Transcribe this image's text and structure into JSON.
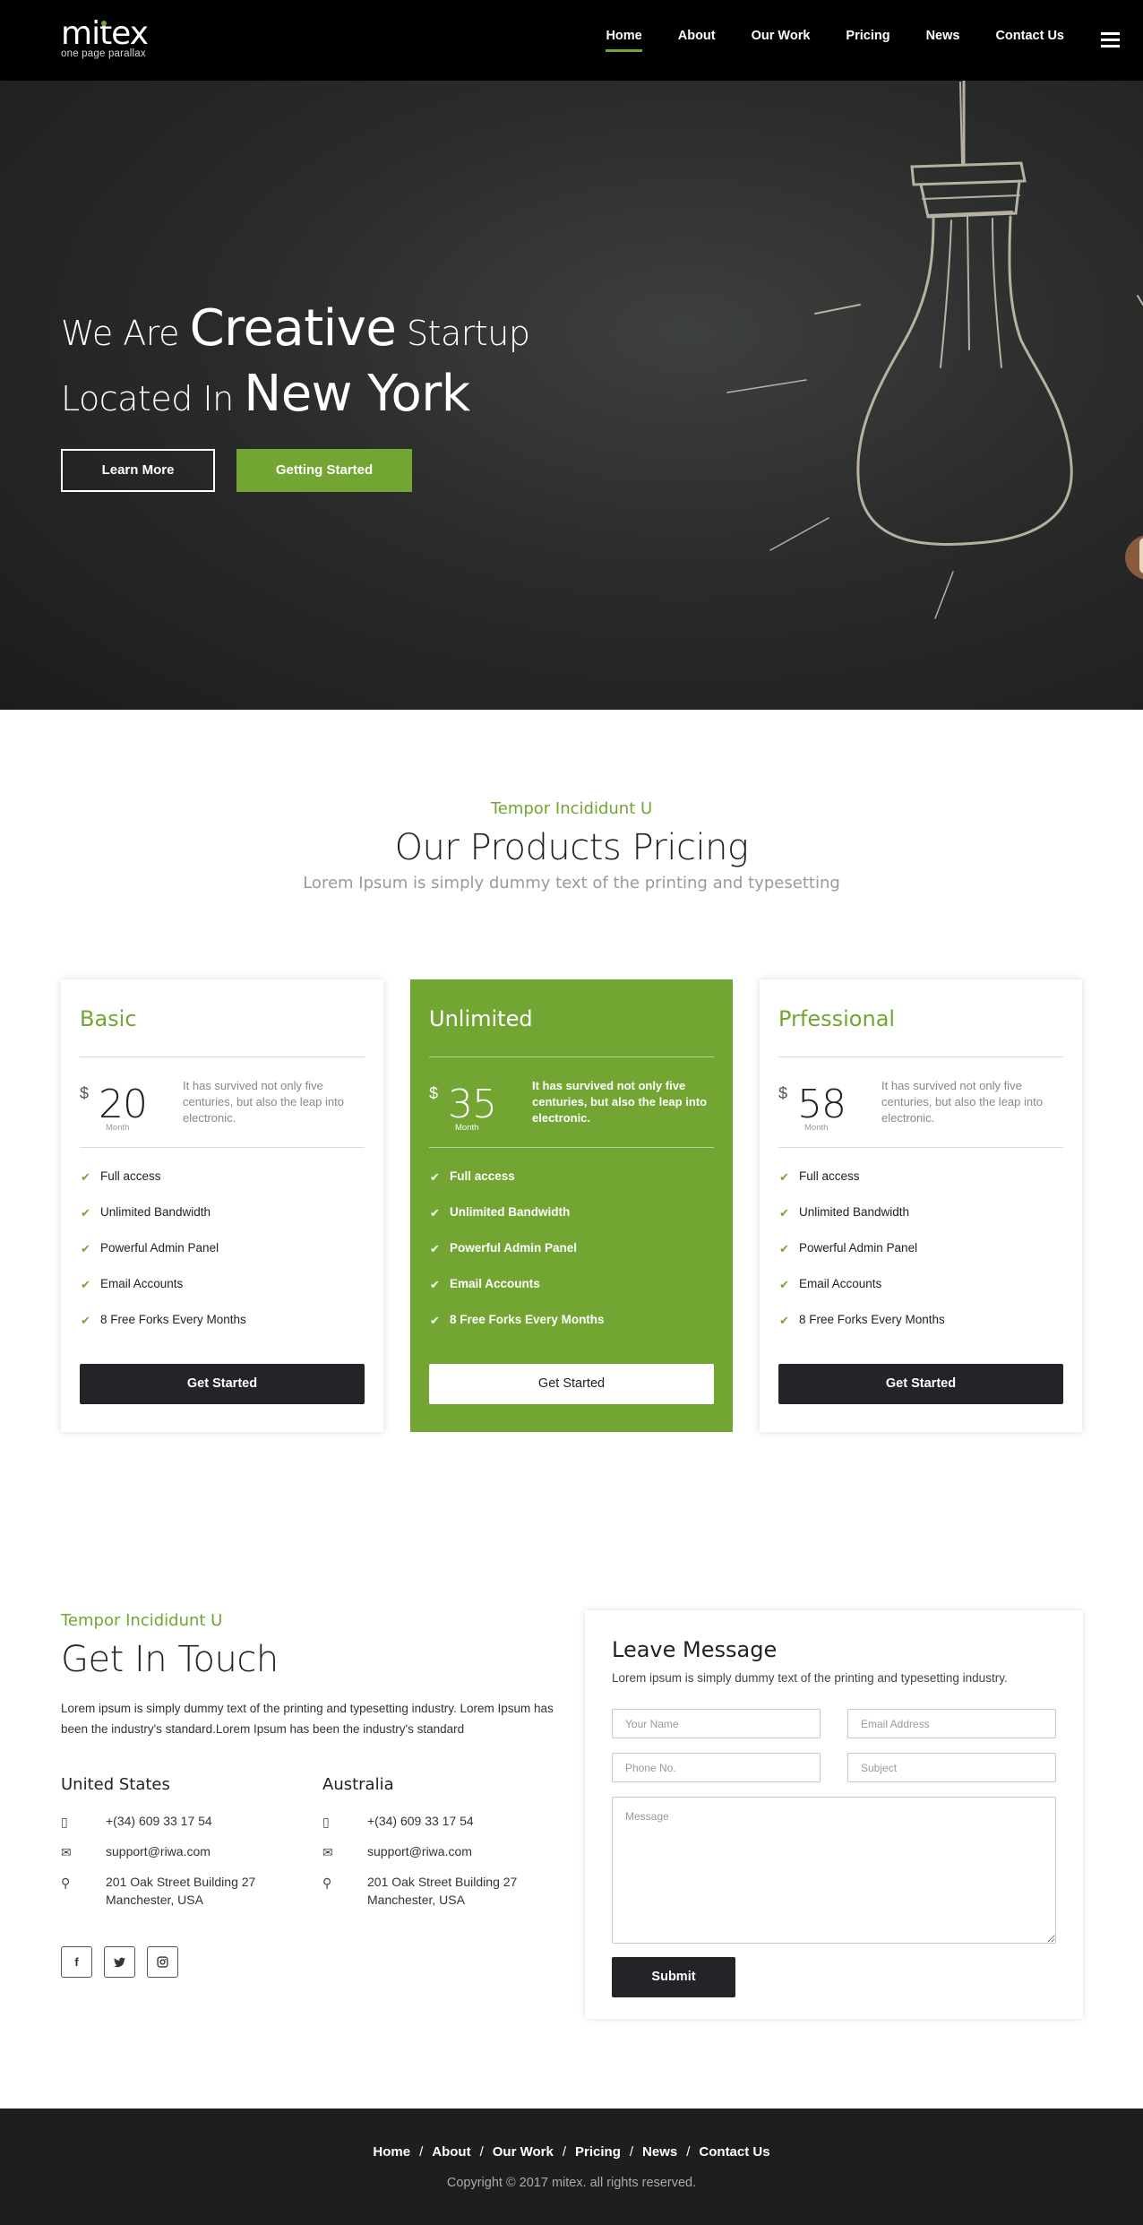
{
  "brand": {
    "name": "mitex",
    "tagline": "one page parallax",
    "accent": "#73a533",
    "dark": "#232428"
  },
  "nav": {
    "links": [
      "Home",
      "About",
      "Our Work",
      "Pricing",
      "News",
      "Contact Us"
    ],
    "active": "Home",
    "menu_icon": "hamburger-icon"
  },
  "hero": {
    "line1_pre": "We Are",
    "line1_big": "Creative",
    "line1_post": "Startup",
    "line2_pre": "Located In",
    "line2_big": "New York",
    "btn_learn": "Learn More",
    "btn_start": "Getting Started"
  },
  "pricing": {
    "eyebrow": "Tempor Incididunt U",
    "title": "Our Products Pricing",
    "subtitle": "Lorem Ipsum is simply dummy text of the printing and typesetting",
    "plans": [
      {
        "name": "Basic",
        "currency": "$",
        "price": "20",
        "period": "Month",
        "desc": "It has survived not only five centuries, but also the leap into electronic.",
        "features": [
          "Full access",
          "Unlimited Bandwidth",
          "Powerful Admin Panel",
          "Email Accounts",
          "8 Free Forks Every Months"
        ],
        "cta": "Get Started"
      },
      {
        "name": "Unlimited",
        "currency": "$",
        "price": "35",
        "period": "Month",
        "desc": "It has survived not only five centuries, but also the leap into electronic.",
        "features": [
          "Full access",
          "Unlimited Bandwidth",
          "Powerful Admin Panel",
          "Email Accounts",
          "8 Free Forks Every Months"
        ],
        "cta": "Get Started"
      },
      {
        "name": "Prfessional",
        "currency": "$",
        "price": "58",
        "period": "Month",
        "desc": "It has survived not only five centuries, but also the leap into electronic.",
        "features": [
          "Full access",
          "Unlimited Bandwidth",
          "Powerful Admin Panel",
          "Email Accounts",
          "8 Free Forks Every Months"
        ],
        "cta": "Get Started"
      }
    ]
  },
  "contact": {
    "eyebrow": "Tempor Incididunt U",
    "title": "Get In Touch",
    "text": "Lorem ipsum is simply dummy text of the printing and typesetting industry. Lorem Ipsum has been the industry's standard.Lorem Ipsum has been the industry's standard",
    "offices": [
      {
        "name": "United States",
        "phone": "+(34) 609 33 17 54",
        "email": "support@riwa.com",
        "address_line1": "201 Oak Street Building 27",
        "address_line2": "Manchester, USA"
      },
      {
        "name": "Australia",
        "phone": "+(34) 609 33 17 54",
        "email": "support@riwa.com",
        "address_line1": "201 Oak Street Building 27",
        "address_line2": "Manchester, USA"
      }
    ],
    "social": [
      "facebook-icon",
      "twitter-icon",
      "instagram-icon"
    ]
  },
  "form": {
    "title": "Leave Message",
    "subtitle": "Lorem ipsum is simply dummy text of the printing and typesetting industry.",
    "name_placeholder": "Your Name",
    "email_placeholder": "Email Address",
    "phone_placeholder": "Phone No.",
    "subject_placeholder": "Subject",
    "message_placeholder": "Message",
    "submit": "Submit"
  },
  "footer": {
    "links": [
      "Home",
      "About",
      "Our Work",
      "Pricing",
      "News",
      "Contact Us"
    ],
    "copyright": "Copyright © 2017 mitex. all rights reserved."
  }
}
